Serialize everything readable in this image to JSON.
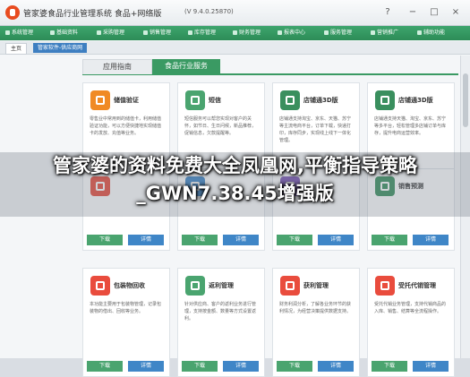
{
  "app": {
    "title": "管家婆食品行业管理系统",
    "edition": "食品+网络版",
    "version": "(V 9.4.0.25870)",
    "window_controls": [
      "?",
      "−",
      "□",
      "×"
    ]
  },
  "nav": {
    "items": [
      "系统管理",
      "基础资料",
      "采购管理",
      "销售管理",
      "库存管理",
      "财务管理",
      "报表中心",
      "服务管理",
      "营销推广",
      "辅助功能"
    ]
  },
  "tabs": {
    "home": "主页",
    "current": "管家软件-供应商网"
  },
  "subtabs": {
    "app_guide": "应用指南",
    "food_service": "食品行业服务"
  },
  "cards": [
    {
      "name": "储值验证",
      "desc": "零售业中常用到的储值卡，利用储值验证功能，可以方便快捷地实现储值卡的发放、充值等业务。",
      "color": "#f08a24"
    },
    {
      "name": "短信",
      "desc": "短信服务可以帮您实现对客户的关怀，如节日、生日问候，新品推荐，促销信息，欠款提醒等。",
      "color": "#4aa46f"
    },
    {
      "name": "店铺通3D版",
      "desc": "店铺通支持淘宝、京东、天猫、苏宁等主流电商平台，订单下载，快递打印，库存同步，实现线上线下一体化管理。",
      "color": "#3a8f5e"
    },
    {
      "name": "店铺通3D版",
      "desc": "店铺通支持天猫、淘宝、京东、苏宁等多平台，轻松管理多店铺订单与库存，提升电商运营效率。",
      "color": "#3a8f5e"
    },
    {
      "name": "",
      "desc": "",
      "color": "#e94c3d"
    },
    {
      "name": "",
      "desc": "",
      "color": "#3f86c7"
    },
    {
      "name": "",
      "desc": "",
      "color": "#7b57b5"
    },
    {
      "name": "销售预测",
      "desc": "",
      "color": "#3a8f5e"
    },
    {
      "name": "包装物回收",
      "desc": "本功能主要用于包装物管理，记录包装物的借出、回收等业务。",
      "color": "#e94c3d"
    },
    {
      "name": "返利管理",
      "desc": "针对供应商、客户的返利业务进行管理，支持按金额、数量等方式设置返利。",
      "color": "#4aa46f"
    },
    {
      "name": "获利管理",
      "desc": "财务利润分析，了解各业务环节的获利情况，为经营决策提供数据支持。",
      "color": "#e94c3d"
    },
    {
      "name": "受托代销管理",
      "desc": "受托代销业务管理，支持代销商品的入库、销售、结算等全流程操作。",
      "color": "#e94c3d"
    }
  ],
  "buttons": {
    "download": "下载",
    "detail": "详情"
  },
  "headline": "管家婆的资料免费大全凤凰网,平衡指导策略_GWN7.38.45增强版"
}
